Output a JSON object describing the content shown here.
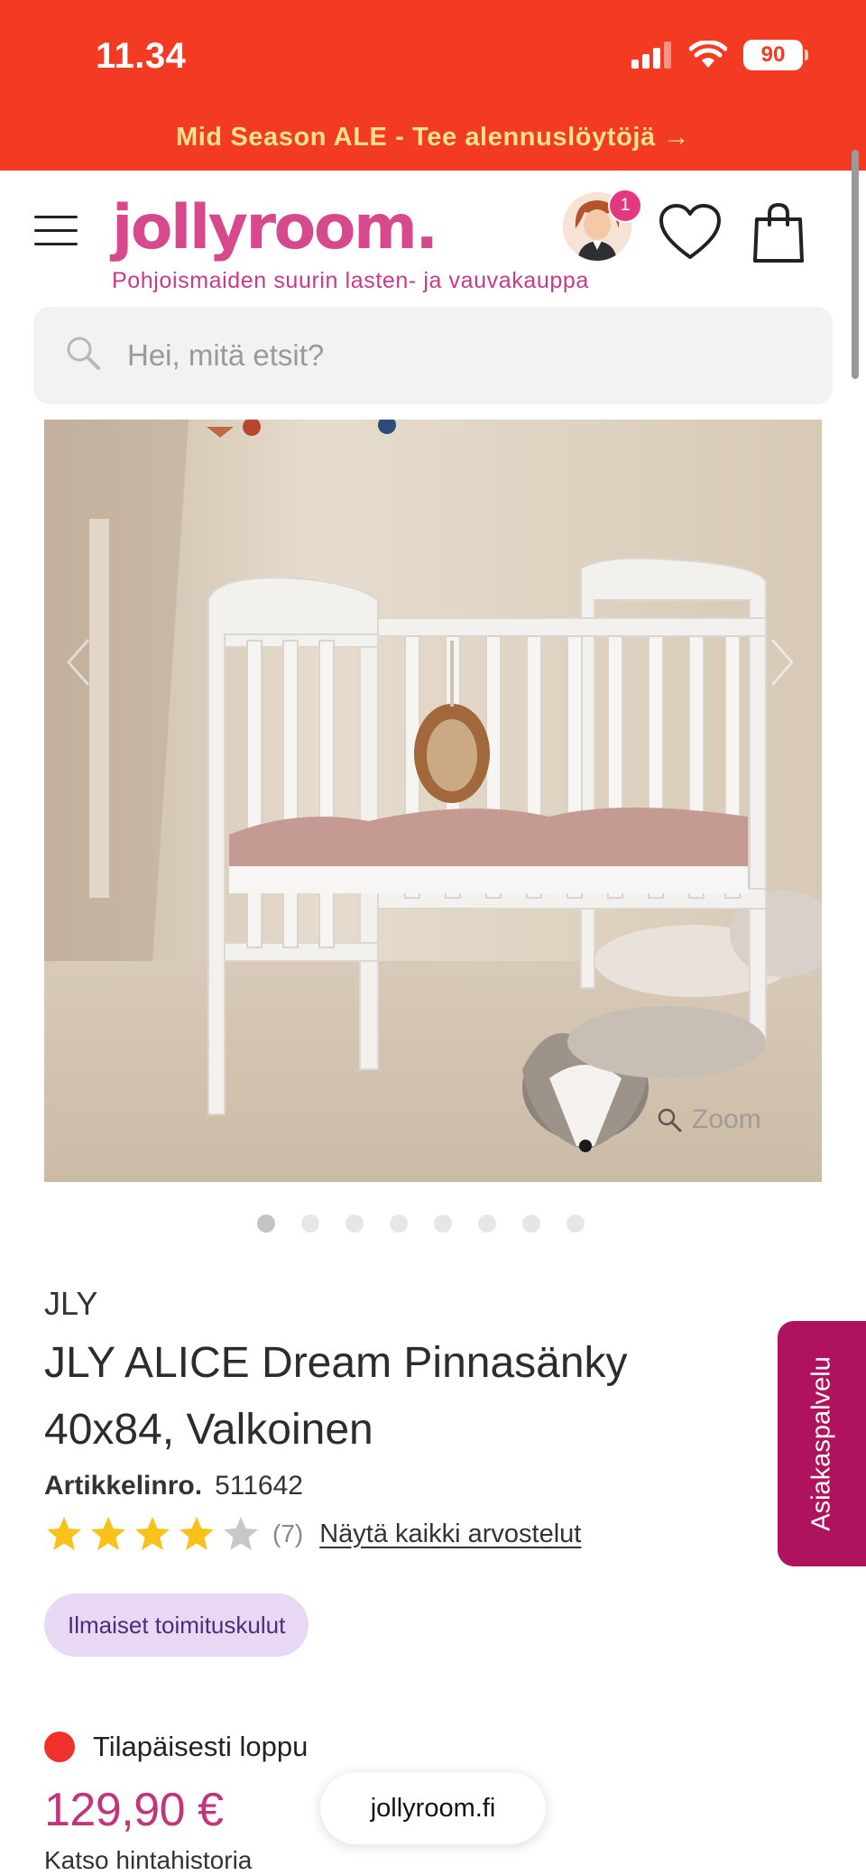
{
  "status_bar": {
    "time": "11.34",
    "battery": "90"
  },
  "promo": {
    "text": "Mid Season ALE - Tee alennuslöytöjä →"
  },
  "header": {
    "logo": "jollyroom.",
    "tagline": "Pohjoismaiden suurin lasten- ja vauvakauppa",
    "avatar_badge": "1"
  },
  "search": {
    "placeholder": "Hei, mitä etsit?"
  },
  "gallery": {
    "zoom_label": "Zoom",
    "slide_count": 8,
    "active_slide": 1
  },
  "product": {
    "brand": "JLY",
    "title": "JLY ALICE Dream Pinnasänky 40x84, Valkoinen",
    "sku_label": "Artikkelinro.",
    "sku": "511642",
    "rating_value": 4,
    "rating_max": 5,
    "rating_count": "(7)",
    "reviews_link": "Näytä kaikki arvostelut",
    "shipping_badge": "Ilmaiset toimituskulut",
    "stock_status": "Tilapäisesti loppu",
    "price": "129,90 €",
    "price_history": "Katso hintahistoria"
  },
  "support": {
    "label": "Asiakaspalvelu"
  },
  "browser": {
    "url": "jollyroom.fi"
  },
  "colors": {
    "brand_pink": "#d64a8d",
    "promo_red": "#f23b22",
    "support_magenta": "#b0135e",
    "stock_red": "#f0302d"
  }
}
